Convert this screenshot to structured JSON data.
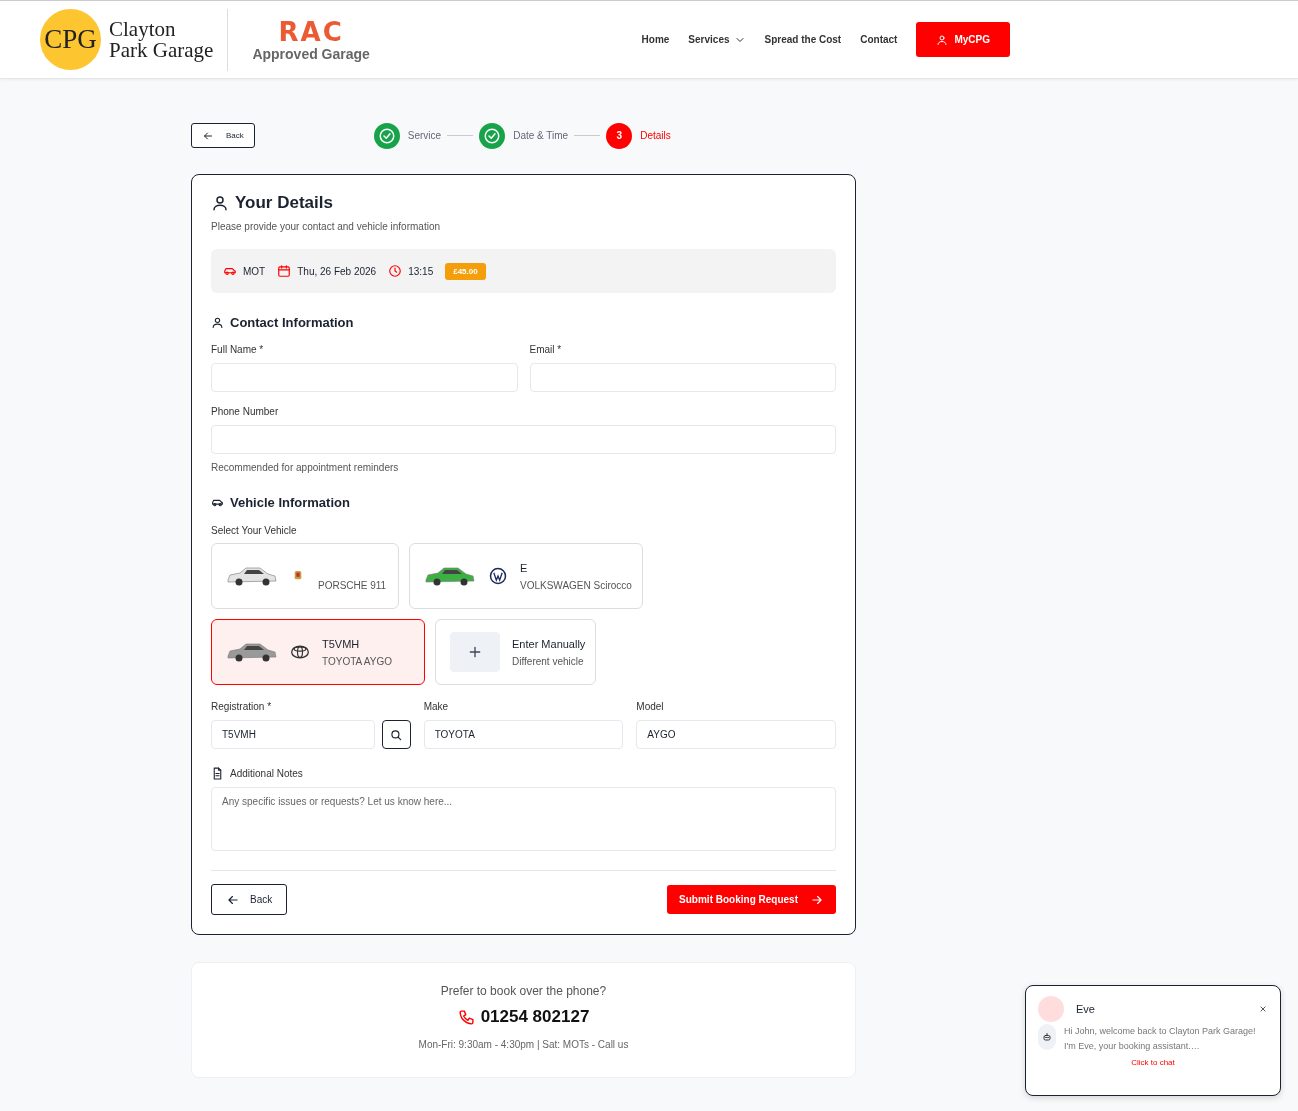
{
  "header": {
    "logo": {
      "initials": "CPG",
      "name_lines": [
        "Clayton",
        "Park Garage"
      ]
    },
    "partner": {
      "brand": "RAC",
      "caption": "Approved Garage"
    },
    "nav": [
      {
        "label": "Home",
        "kind": "link"
      },
      {
        "label": "Services",
        "kind": "dropdown"
      },
      {
        "label": "Spread the Cost",
        "kind": "link"
      },
      {
        "label": "Contact",
        "kind": "link"
      }
    ],
    "account_button": "MyCPG"
  },
  "stepper": {
    "back": "Back",
    "steps": [
      {
        "label": "Service",
        "completed": true,
        "selected": false
      },
      {
        "label": "Date & Time",
        "completed": true,
        "selected": false
      },
      {
        "label": "Details",
        "number": "3",
        "completed": false,
        "selected": true
      }
    ]
  },
  "details": {
    "title": "Your Details",
    "subtitle": "Please provide your contact and vehicle information",
    "summary": [
      {
        "kind": "service",
        "text": "MOT"
      },
      {
        "kind": "date",
        "text": "Thu, 26 Feb 2026"
      },
      {
        "kind": "time",
        "text": "13:15"
      }
    ],
    "price": "£45.00",
    "contact": {
      "heading": "Contact Information",
      "fields": [
        {
          "label": "Full Name *"
        },
        {
          "label": "Email *"
        },
        {
          "label": "Phone Number",
          "hint": "Recommended for appointment reminders"
        }
      ]
    },
    "vehicle": {
      "heading": "Vehicle Information",
      "select_label": "Select Your Vehicle",
      "vehicles": [
        {
          "description": "PORSCHE 911",
          "kind": "porsche",
          "color": "#e4e4e4",
          "selected": false
        },
        {
          "registration": "E",
          "description": "VOLKSWAGEN Scirocco",
          "kind": "volkswagen",
          "color": "#3cb043",
          "selected": false
        },
        {
          "registration": "T5VMH",
          "description": "TOYOTA AYGO",
          "kind": "toyota",
          "color": "#9a9a9a",
          "selected": true
        }
      ],
      "manual": {
        "title": "Enter Manually",
        "subtitle": "Different vehicle"
      },
      "fields": [
        {
          "label": "Registration *",
          "value": "T5VMH",
          "kind": "lookup"
        },
        {
          "label": "Make",
          "value": "TOYOTA",
          "kind": "text"
        },
        {
          "label": "Model",
          "value": "AYGO",
          "kind": "text"
        }
      ]
    },
    "notes": {
      "label": "Additional Notes",
      "placeholder": "Any specific issues or requests? Let us know here..."
    },
    "back": "Back",
    "submit": "Submit Booking Request"
  },
  "phone_card": {
    "prompt": "Prefer to book over the phone?",
    "number": "01254 802127",
    "hours": "Mon-Fri: 9:30am - 4:30pm | Sat: MOTs - Call us"
  },
  "chat": {
    "name": "Eve",
    "message": "Hi John, welcome back to Clayton Park Garage! I'm Eve, your booking assistant.…",
    "action": "Click to chat"
  }
}
